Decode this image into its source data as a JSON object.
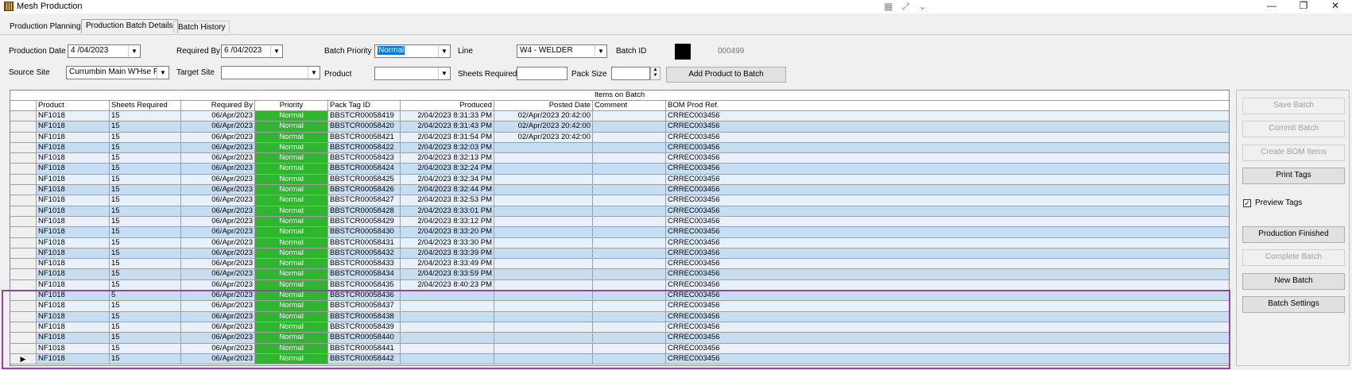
{
  "window": {
    "title": "Mesh Production",
    "minimize": "—",
    "restore": "❐",
    "close": "✕",
    "extra_tools": "▦ ⤢ ⌄"
  },
  "tabs": [
    {
      "label": "Production Planning"
    },
    {
      "label": "Production Batch Details"
    },
    {
      "label": "Batch History"
    }
  ],
  "form": {
    "production_date_label": "Production Date",
    "production_date_value": "4 /04/2023",
    "required_by_label": "Required By",
    "required_by_value": "6 /04/2023",
    "batch_priority_label": "Batch Priority",
    "batch_priority_value": "Normal",
    "line_label": "Line",
    "line_value": "W4 - WELDER",
    "batch_id_label": "Batch ID",
    "batch_id_value": "000499",
    "source_site_label": "Source Site",
    "source_site_value": "Currumbin Main W'Hse Fa",
    "target_site_label": "Target Site",
    "target_site_value": "",
    "product_label": "Product",
    "product_value": "",
    "sheets_required_label": "Sheets Required",
    "sheets_required_value": "",
    "pack_size_label": "Pack Size",
    "pack_size_value": "",
    "add_product_button": "Add Product to Batch"
  },
  "grid": {
    "caption": "Items on Batch",
    "columns": [
      "Product",
      "Sheets Required",
      "Required By",
      "Priority",
      "Pack Tag ID",
      "Produced",
      "Posted Date",
      "Comment",
      "BOM Prod Ref."
    ],
    "current_row_marker": "▶",
    "rows": [
      {
        "product": "NF1018",
        "sheets": "15",
        "required_by": "06/Apr/2023",
        "priority": "Normal",
        "pack_tag": "BBSTCR00058419",
        "produced": "2/04/2023 8:31:33 PM",
        "posted": "02/Apr/2023 20:42:00",
        "comment": "",
        "bom": "CRREC003456"
      },
      {
        "product": "NF1018",
        "sheets": "15",
        "required_by": "06/Apr/2023",
        "priority": "Normal",
        "pack_tag": "BBSTCR00058420",
        "produced": "2/04/2023 8:31:43 PM",
        "posted": "02/Apr/2023 20:42:00",
        "comment": "",
        "bom": "CRREC003456"
      },
      {
        "product": "NF1018",
        "sheets": "15",
        "required_by": "06/Apr/2023",
        "priority": "Normal",
        "pack_tag": "BBSTCR00058421",
        "produced": "2/04/2023 8:31:54 PM",
        "posted": "02/Apr/2023 20:42:00",
        "comment": "",
        "bom": "CRREC003456"
      },
      {
        "product": "NF1018",
        "sheets": "15",
        "required_by": "06/Apr/2023",
        "priority": "Normal",
        "pack_tag": "BBSTCR00058422",
        "produced": "2/04/2023 8:32:03 PM",
        "posted": "",
        "comment": "",
        "bom": "CRREC003456"
      },
      {
        "product": "NF1018",
        "sheets": "15",
        "required_by": "06/Apr/2023",
        "priority": "Normal",
        "pack_tag": "BBSTCR00058423",
        "produced": "2/04/2023 8:32:13 PM",
        "posted": "",
        "comment": "",
        "bom": "CRREC003456"
      },
      {
        "product": "NF1018",
        "sheets": "15",
        "required_by": "06/Apr/2023",
        "priority": "Normal",
        "pack_tag": "BBSTCR00058424",
        "produced": "2/04/2023 8:32:24 PM",
        "posted": "",
        "comment": "",
        "bom": "CRREC003456"
      },
      {
        "product": "NF1018",
        "sheets": "15",
        "required_by": "06/Apr/2023",
        "priority": "Normal",
        "pack_tag": "BBSTCR00058425",
        "produced": "2/04/2023 8:32:34 PM",
        "posted": "",
        "comment": "",
        "bom": "CRREC003456"
      },
      {
        "product": "NF1018",
        "sheets": "15",
        "required_by": "06/Apr/2023",
        "priority": "Normal",
        "pack_tag": "BBSTCR00058426",
        "produced": "2/04/2023 8:32:44 PM",
        "posted": "",
        "comment": "",
        "bom": "CRREC003456"
      },
      {
        "product": "NF1018",
        "sheets": "15",
        "required_by": "06/Apr/2023",
        "priority": "Normal",
        "pack_tag": "BBSTCR00058427",
        "produced": "2/04/2023 8:32:53 PM",
        "posted": "",
        "comment": "",
        "bom": "CRREC003456"
      },
      {
        "product": "NF1018",
        "sheets": "15",
        "required_by": "06/Apr/2023",
        "priority": "Normal",
        "pack_tag": "BBSTCR00058428",
        "produced": "2/04/2023 8:33:01 PM",
        "posted": "",
        "comment": "",
        "bom": "CRREC003456"
      },
      {
        "product": "NF1018",
        "sheets": "15",
        "required_by": "06/Apr/2023",
        "priority": "Normal",
        "pack_tag": "BBSTCR00058429",
        "produced": "2/04/2023 8:33:12 PM",
        "posted": "",
        "comment": "",
        "bom": "CRREC003456"
      },
      {
        "product": "NF1018",
        "sheets": "15",
        "required_by": "06/Apr/2023",
        "priority": "Normal",
        "pack_tag": "BBSTCR00058430",
        "produced": "2/04/2023 8:33:20 PM",
        "posted": "",
        "comment": "",
        "bom": "CRREC003456"
      },
      {
        "product": "NF1018",
        "sheets": "15",
        "required_by": "06/Apr/2023",
        "priority": "Normal",
        "pack_tag": "BBSTCR00058431",
        "produced": "2/04/2023 8:33:30 PM",
        "posted": "",
        "comment": "",
        "bom": "CRREC003456"
      },
      {
        "product": "NF1018",
        "sheets": "15",
        "required_by": "06/Apr/2023",
        "priority": "Normal",
        "pack_tag": "BBSTCR00058432",
        "produced": "2/04/2023 8:33:39 PM",
        "posted": "",
        "comment": "",
        "bom": "CRREC003456"
      },
      {
        "product": "NF1018",
        "sheets": "15",
        "required_by": "06/Apr/2023",
        "priority": "Normal",
        "pack_tag": "BBSTCR00058433",
        "produced": "2/04/2023 8:33:49 PM",
        "posted": "",
        "comment": "",
        "bom": "CRREC003456"
      },
      {
        "product": "NF1018",
        "sheets": "15",
        "required_by": "06/Apr/2023",
        "priority": "Normal",
        "pack_tag": "BBSTCR00058434",
        "produced": "2/04/2023 8:33:59 PM",
        "posted": "",
        "comment": "",
        "bom": "CRREC003456"
      },
      {
        "product": "NF1018",
        "sheets": "15",
        "required_by": "06/Apr/2023",
        "priority": "Normal",
        "pack_tag": "BBSTCR00058435",
        "produced": "2/04/2023 8:40:23 PM",
        "posted": "",
        "comment": "",
        "bom": "CRREC003456"
      },
      {
        "product": "NF1018",
        "sheets": "5",
        "required_by": "06/Apr/2023",
        "priority": "Normal",
        "pack_tag": "BBSTCR00058436",
        "produced": "",
        "posted": "",
        "comment": "",
        "bom": "CRREC003456"
      },
      {
        "product": "NF1018",
        "sheets": "15",
        "required_by": "06/Apr/2023",
        "priority": "Normal",
        "pack_tag": "BBSTCR00058437",
        "produced": "",
        "posted": "",
        "comment": "",
        "bom": "CRREC003456"
      },
      {
        "product": "NF1018",
        "sheets": "15",
        "required_by": "06/Apr/2023",
        "priority": "Normal",
        "pack_tag": "BBSTCR00058438",
        "produced": "",
        "posted": "",
        "comment": "",
        "bom": "CRREC003456"
      },
      {
        "product": "NF1018",
        "sheets": "15",
        "required_by": "06/Apr/2023",
        "priority": "Normal",
        "pack_tag": "BBSTCR00058439",
        "produced": "",
        "posted": "",
        "comment": "",
        "bom": "CRREC003456"
      },
      {
        "product": "NF1018",
        "sheets": "15",
        "required_by": "06/Apr/2023",
        "priority": "Normal",
        "pack_tag": "BBSTCR00058440",
        "produced": "",
        "posted": "",
        "comment": "",
        "bom": "CRREC003456"
      },
      {
        "product": "NF1018",
        "sheets": "15",
        "required_by": "06/Apr/2023",
        "priority": "Normal",
        "pack_tag": "BBSTCR00058441",
        "produced": "",
        "posted": "",
        "comment": "",
        "bom": "CRREC003456"
      },
      {
        "product": "NF1018",
        "sheets": "15",
        "required_by": "06/Apr/2023",
        "priority": "Normal",
        "pack_tag": "BBSTCR00058442",
        "produced": "",
        "posted": "",
        "comment": "",
        "bom": "CRREC003456"
      }
    ]
  },
  "side_buttons": {
    "save_batch": "Save Batch",
    "commit_batch": "Commit Batch",
    "create_bom_items": "Create BOM Items",
    "print_tags": "Print Tags",
    "preview_tags_label": "Preview Tags",
    "preview_tags_checked": "✓",
    "production_finished": "Production Finished",
    "complete_batch": "Complete Batch",
    "new_batch": "New Batch",
    "batch_settings": "Batch Settings"
  },
  "colors": {
    "priority_normal": "#2fb52f",
    "row_alt_dark": "#c7def2",
    "row_alt_light": "#e8f1fa",
    "annotation_border": "#9b3fb0"
  }
}
